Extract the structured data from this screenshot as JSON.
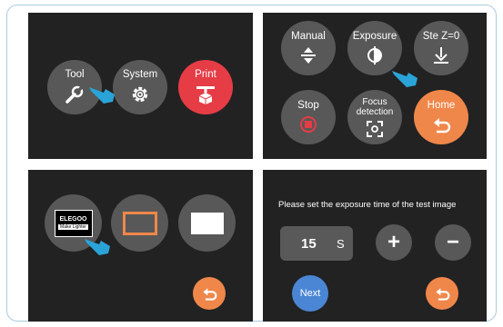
{
  "panel1": {
    "tool_label": "Tool",
    "system_label": "System",
    "print_label": "Print"
  },
  "panel2": {
    "manual_label": "Manual",
    "exposure_label": "Exposure",
    "setz_label": "Ste Z=0",
    "stop_label": "Stop",
    "focus_label_line1": "Focus",
    "focus_label_line2": "detection",
    "home_label": "Home"
  },
  "panel3": {
    "logo_text": "ELEGOO",
    "logo_subtext": "Make Lighter"
  },
  "panel4": {
    "prompt": "Please set the exposure time of the test image",
    "exposure_value": "15",
    "unit": "S",
    "plus_symbol": "+",
    "minus_symbol": "−",
    "next_label": "Next"
  },
  "colors": {
    "panel_bg": "#222222",
    "button_gray": "#585858",
    "print_red": "#e53c46",
    "accent_orange": "#f0874a",
    "next_blue": "#4a86d4",
    "pointer_blue": "#2aa4d8",
    "frame_border": "#a9cbe0"
  },
  "icons": [
    "wrench-icon",
    "gear-icon",
    "print-icon",
    "up-down-arrows-icon",
    "exposure-icon",
    "download-arrow-icon",
    "stop-icon",
    "focus-icon",
    "return-icon",
    "hand-pointer-icon"
  ]
}
